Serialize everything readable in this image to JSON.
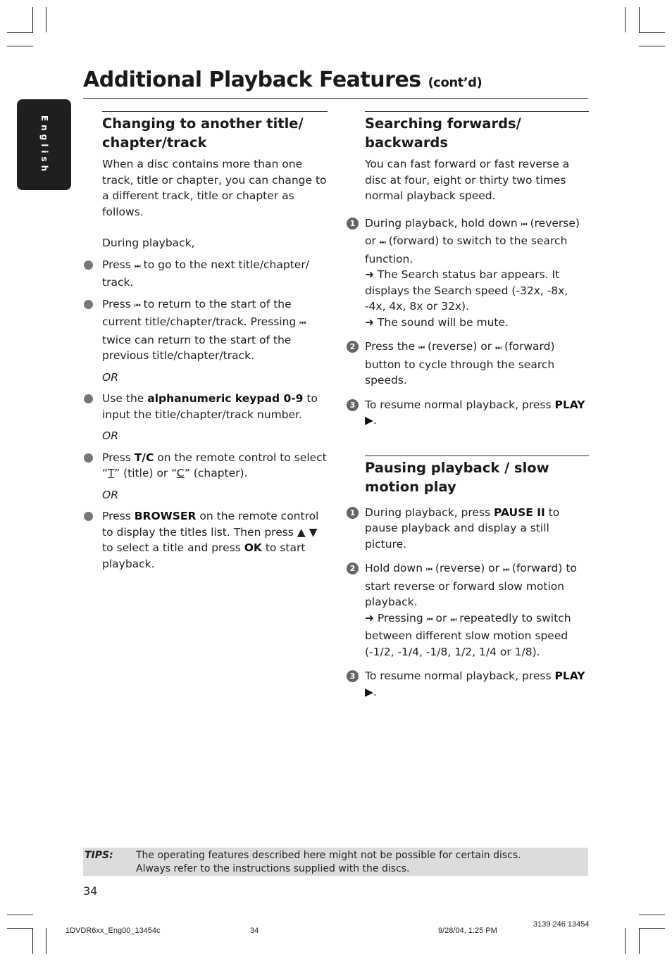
{
  "page": {
    "title": "Additional Playback Features",
    "title_suffix": "(cont’d)",
    "language_tab": "English"
  },
  "left": {
    "heading_line1": "Changing to another title/",
    "heading_line2": "chapter/track",
    "intro": "When a disc contains more than one track, title or chapter, you can change to a different track, title or chapter as follows.",
    "during": "During playback,",
    "bullet1_a": "Press ",
    "bullet1_icon": "⏭",
    "bullet1_b": " to go to the next title/chapter/ track.",
    "bullet2_a": "Press ",
    "bullet2_icon": "⏮",
    "bullet2_b": " to return to the start of the current title/chapter/track.  Pressing ",
    "bullet2_icon2": "⏮",
    "bullet2_c": " twice can return to the start of the previous title/chapter/track.",
    "or": "OR",
    "bullet3_a": "Use the ",
    "bullet3_bold": "alphanumeric keypad 0-9",
    "bullet3_b": " to input the title/chapter/track number.",
    "bullet4_a": "Press ",
    "bullet4_bold": "T/C",
    "bullet4_b": " on the remote control to select “",
    "bullet4_t": "T",
    "bullet4_c": "” (title) or “",
    "bullet4_cc": "C",
    "bullet4_d": "” (chapter).",
    "bullet5_a": "Press ",
    "bullet5_bold": "BROWSER",
    "bullet5_b": " on the remote control to display the titles list. Then press ▲ ▼ to select a title and press ",
    "bullet5_ok": "OK",
    "bullet5_c": " to start playback."
  },
  "right": {
    "search_heading_line1": "Searching forwards/",
    "search_heading_line2": "backwards",
    "search_intro": "You can fast forward or fast reverse a disc at four, eight or thirty two times normal playback speed.",
    "s1_a": "During playback, hold down ",
    "s1_b": "  (reverse) or ",
    "s1_c": " (forward) to switch to the search function.",
    "s1_r1": "➜ The Search status bar appears.  It displays the Search speed (-32x, -8x, -4x, 4x, 8x or 32x).",
    "s1_r2": "➜ The sound will be mute.",
    "s2_a": "Press the ",
    "s2_b": "  (reverse) or ",
    "s2_c": " (forward) button to cycle through the search speeds.",
    "s3_a": "To resume normal playback, press ",
    "s3_bold": "PLAY ▶",
    "pause_heading_line1": "Pausing playback / slow",
    "pause_heading_line2": "motion play",
    "p1_a": "During playback, press ",
    "p1_bold": "PAUSE II",
    "p1_b": " to pause playback and display a still picture.",
    "p2_a": "Hold down ",
    "p2_b": "  (reverse) or ",
    "p2_c": " (forward) to start reverse or forward slow motion playback.",
    "p2_r1a": "➜ Pressing ",
    "p2_r1b": " or ",
    "p2_r1c": " repeatedly to switch between different slow motion speed (-1/2, -1/4, -1/8, 1/2, 1/4 or 1/8).",
    "p3_a": "To resume normal playback, press ",
    "p3_bold": "PLAY ▶",
    "rev_icon": "⏮",
    "fwd_icon": "⏭",
    "n1": "1",
    "n2": "2",
    "n3": "3"
  },
  "tips": {
    "label": "TIPS:",
    "line1": "The operating features described here might not be possible for certain discs.",
    "line2": "Always refer to the instructions supplied with the discs."
  },
  "page_number": "34",
  "footer": {
    "file": "1DVDR6xx_Eng00_13454c",
    "page": "34",
    "date": "9/28/04, 1:25 PM",
    "code": "3139 246 13454"
  }
}
